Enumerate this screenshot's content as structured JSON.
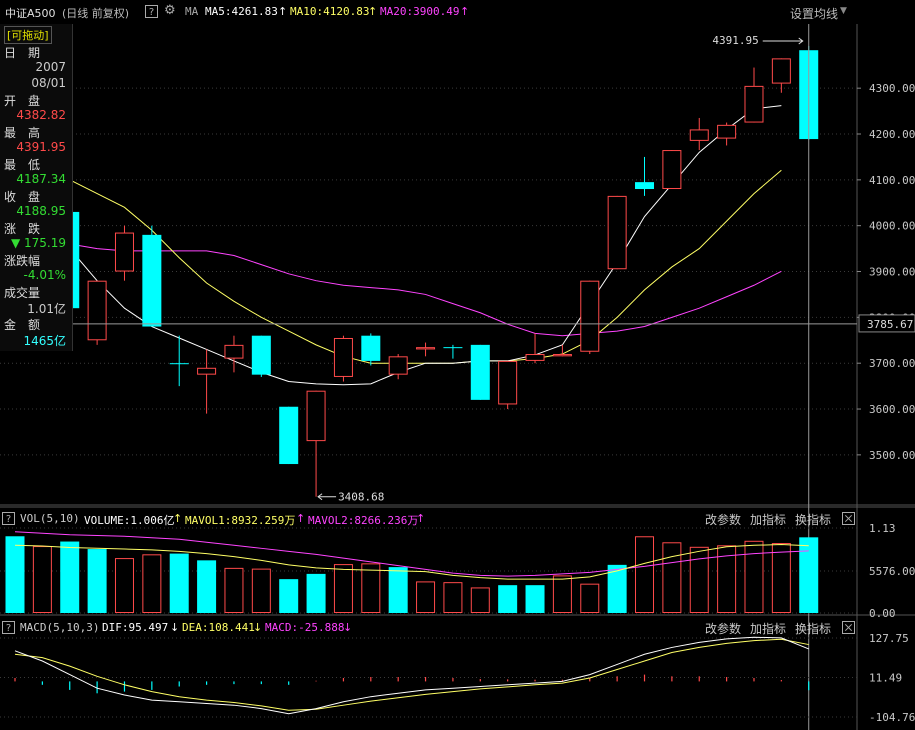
{
  "header": {
    "index_name": "中证A500",
    "period": "(日线 前复权)",
    "ma_label": "MA",
    "ma5": "MA5:4261.83",
    "ma10": "MA10:4120.83",
    "ma20": "MA20:3900.49",
    "settings": "设置均线"
  },
  "info_panel": {
    "drag": "[可拖动]",
    "date_label": "日　期",
    "year": "2007",
    "date": "08/01",
    "open_label": "开　盘",
    "open": "4382.82",
    "high_label": "最　高",
    "high": "4391.95",
    "low_label": "最　低",
    "low": "4187.34",
    "close_label": "收　盘",
    "close": "4188.95",
    "change_label": "涨　跌",
    "change": "▼ 175.19",
    "pct_label": "涨跌幅",
    "pct": "-4.01%",
    "volume_label": "成交量",
    "volume": "1.01亿",
    "amount_label": "金　额",
    "amount": "1465亿"
  },
  "vol_header": {
    "title": "VOL(5,10)",
    "volume": "VOLUME:1.006亿",
    "mavol1": "MAVOL1:8932.259万",
    "mavol2": "MAVOL2:8266.236万"
  },
  "macd_header": {
    "title": "MACD(5,10,3)",
    "dif": "DIF:95.497",
    "dea": "DEA:108.441",
    "macd": "MACD:-25.888"
  },
  "panel_buttons": {
    "params": "改参数",
    "add": "加指标",
    "switch": "换指标"
  },
  "colors": {
    "up": "#ff4a4a",
    "down": "#00ffff",
    "ma5": "#ffffff",
    "ma10": "#ffff66",
    "ma20": "#ff44ff",
    "axis": "#c8c8c8",
    "grid": "#3a3a3a"
  },
  "chart_data": [
    {
      "type": "candlestick",
      "name": "price",
      "y_ticks": [
        3500,
        3600,
        3700,
        3800,
        3900,
        4000,
        4100,
        4200,
        4300
      ],
      "y_tick_labels": [
        "3500.00",
        "3600.00",
        "3700.00",
        "3800.00",
        "3900.00",
        "4000.00",
        "4100.00",
        "4200.00",
        "4300.00"
      ],
      "ylim": [
        3395,
        4440
      ],
      "crosshair_value": 3785.67,
      "crosshair_label": "3785.67",
      "high_marker": "4391.95",
      "low_marker": "3408.68",
      "candles": [
        {
          "o": 4175,
          "c": 4020,
          "h": 4175,
          "l": 4020
        },
        {
          "o": 4030,
          "c": 3820,
          "h": 4030,
          "l": 3810
        },
        {
          "o": 3750,
          "c": 3880,
          "h": 3880,
          "l": 3740
        },
        {
          "o": 3900,
          "c": 3985,
          "h": 4000,
          "l": 3880
        },
        {
          "o": 3980,
          "c": 3780,
          "h": 4000,
          "l": 3780
        },
        {
          "o": 3700,
          "c": 3700,
          "h": 3760,
          "l": 3650
        },
        {
          "o": 3675,
          "c": 3690,
          "h": 3730,
          "l": 3590
        },
        {
          "o": 3710,
          "c": 3740,
          "h": 3760,
          "l": 3680
        },
        {
          "o": 3760,
          "c": 3675,
          "h": 3760,
          "l": 3670
        },
        {
          "o": 3605,
          "c": 3480,
          "h": 3605,
          "l": 3480
        },
        {
          "o": 3530,
          "c": 3640,
          "h": 3640,
          "l": 3408.68
        },
        {
          "o": 3670,
          "c": 3755,
          "h": 3760,
          "l": 3660
        },
        {
          "o": 3760,
          "c": 3705,
          "h": 3765,
          "l": 3695
        },
        {
          "o": 3675,
          "c": 3715,
          "h": 3720,
          "l": 3665
        },
        {
          "o": 3730,
          "c": 3735,
          "h": 3745,
          "l": 3715
        },
        {
          "o": 3735,
          "c": 3733,
          "h": 3740,
          "l": 3710
        },
        {
          "o": 3740,
          "c": 3620,
          "h": 3740,
          "l": 3620
        },
        {
          "o": 3610,
          "c": 3705,
          "h": 3705,
          "l": 3600
        },
        {
          "o": 3705,
          "c": 3720,
          "h": 3765,
          "l": 3700
        },
        {
          "o": 3715,
          "c": 3720,
          "h": 3740,
          "l": 3715
        },
        {
          "o": 3725,
          "c": 3880,
          "h": 3880,
          "l": 3720
        },
        {
          "o": 3905,
          "c": 4065,
          "h": 4065,
          "l": 3905
        },
        {
          "o": 4095,
          "c": 4080,
          "h": 4150,
          "l": 4065
        },
        {
          "o": 4080,
          "c": 4165,
          "h": 4165,
          "l": 4080
        },
        {
          "o": 4185,
          "c": 4210,
          "h": 4235,
          "l": 4165
        },
        {
          "o": 4190,
          "c": 4220,
          "h": 4225,
          "l": 4175
        },
        {
          "o": 4225,
          "c": 4305,
          "h": 4345,
          "l": 4225
        },
        {
          "o": 4310,
          "c": 4365,
          "h": 4365,
          "l": 4290
        },
        {
          "o": 4382.82,
          "c": 4188.95,
          "h": 4391.95,
          "l": 4187.34
        }
      ],
      "ma5": [
        4100,
        4030,
        3950,
        3880,
        3820,
        3780,
        3755,
        3730,
        3705,
        3680,
        3660,
        3655,
        3653,
        3655,
        3680,
        3700,
        3700,
        3705,
        3705,
        3718,
        3740,
        3830,
        3920,
        4020,
        4090,
        4160,
        4210,
        4255,
        4261.83
      ],
      "ma10": [
        4160,
        4130,
        4100,
        4070,
        4040,
        3990,
        3930,
        3875,
        3835,
        3800,
        3770,
        3740,
        3715,
        3700,
        3700,
        3700,
        3700,
        3705,
        3705,
        3710,
        3720,
        3750,
        3800,
        3860,
        3910,
        3950,
        4010,
        4070,
        4120.83
      ],
      "ma20": [
        3990,
        3970,
        3960,
        3950,
        3945,
        3945,
        3945,
        3945,
        3935,
        3915,
        3895,
        3880,
        3870,
        3865,
        3860,
        3850,
        3830,
        3810,
        3785,
        3765,
        3760,
        3765,
        3770,
        3780,
        3800,
        3820,
        3845,
        3870,
        3900.49
      ]
    },
    {
      "type": "bar",
      "name": "volume",
      "unit": "万",
      "y_tick_labels": [
        "1.13",
        "5576.00",
        "0.00"
      ],
      "ylim": [
        0,
        11300
      ],
      "values": [
        10200,
        8900,
        9500,
        8500,
        7300,
        7800,
        7900,
        7000,
        6000,
        5900,
        4500,
        5200,
        6500,
        6600,
        6100,
        4200,
        4100,
        3400,
        3700,
        3700,
        5000,
        3900,
        6400,
        10200,
        9400,
        8800,
        9000,
        9600,
        9300,
        10060
      ],
      "up": [
        false,
        true,
        false,
        false,
        true,
        true,
        false,
        false,
        true,
        true,
        false,
        false,
        true,
        true,
        false,
        true,
        true,
        true,
        false,
        false,
        true,
        true,
        false,
        true,
        true,
        true,
        true,
        true,
        true,
        false
      ],
      "mavol1": [
        9000,
        8900,
        8700,
        8600,
        8500,
        8400,
        8200,
        7900,
        7500,
        7000,
        6400,
        6000,
        5800,
        5700,
        5600,
        5500,
        5000,
        4700,
        4500,
        4500,
        4500,
        4800,
        5600,
        6600,
        7500,
        8200,
        8800,
        9000,
        9100,
        8932.259
      ],
      "mavol2": [
        10800,
        10600,
        10400,
        10300,
        10200,
        10000,
        9800,
        9400,
        9000,
        8600,
        8200,
        7800,
        7300,
        6800,
        6300,
        5800,
        5300,
        5000,
        4900,
        5000,
        5200,
        5400,
        5800,
        6200,
        6700,
        7200,
        7600,
        7900,
        8100,
        8266.236
      ]
    },
    {
      "type": "line",
      "name": "macd",
      "y_tick_labels": [
        "127.75",
        "11.49",
        "-104.76"
      ],
      "ylim": [
        -104.76,
        127.75
      ],
      "dif": [
        90,
        60,
        20,
        -20,
        -40,
        -55,
        -60,
        -65,
        -70,
        -80,
        -95,
        -80,
        -60,
        -45,
        -35,
        -25,
        -20,
        -15,
        -10,
        -5,
        0,
        20,
        50,
        80,
        100,
        115,
        125,
        130,
        128,
        95.497
      ],
      "dea": [
        80,
        70,
        45,
        15,
        -10,
        -30,
        -45,
        -55,
        -62,
        -72,
        -85,
        -82,
        -70,
        -58,
        -48,
        -38,
        -30,
        -22,
        -16,
        -10,
        -5,
        10,
        35,
        60,
        85,
        100,
        112,
        120,
        124,
        108.441
      ],
      "macd": [
        10,
        -10,
        -25,
        -35,
        -30,
        -25,
        -15,
        -10,
        -8,
        -8,
        -10,
        2,
        10,
        13,
        13,
        13,
        10,
        7,
        6,
        5,
        5,
        10,
        15,
        20,
        15,
        15,
        13,
        10,
        4,
        -25.888
      ]
    }
  ]
}
